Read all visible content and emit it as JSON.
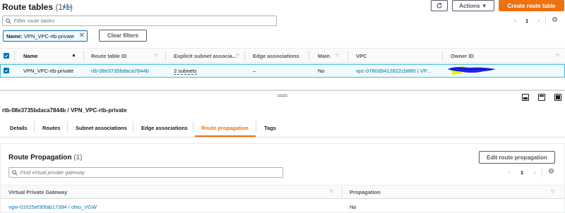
{
  "header": {
    "title": "Route tables",
    "count": "(1/1)",
    "info_label": "Info",
    "actions_label": "Actions ▼",
    "create_label": "Create route table"
  },
  "filter": {
    "placeholder": "Filter route tables",
    "chip_key": "Name:",
    "chip_value": "VPN_VPC-rtb-private",
    "clear_label": "Clear filters"
  },
  "pagination_top": {
    "page": "1"
  },
  "route_table": {
    "columns": [
      "Name",
      "Route table ID",
      "Explicit subnet associa...",
      "Edge associations",
      "Main",
      "VPC",
      "Owner ID"
    ],
    "row": {
      "name": "VPN_VPC-rtb-private",
      "route_table_id": "rtb-08e3735bdaca7844b",
      "subnets": "2 subnets",
      "edge": "–",
      "main": "No",
      "vpc": "vpc-0780d9412822cb880 | VP..."
    }
  },
  "detail": {
    "breadcrumb": "rtb-08e3735bdaca7844b / VPN_VPC-rtb-private",
    "tabs": [
      "Details",
      "Routes",
      "Subnet associations",
      "Edge associations",
      "Route propagation",
      "Tags"
    ],
    "active_tab": "Route propagation"
  },
  "propagation": {
    "title": "Route Propagation",
    "count": "(1)",
    "edit_label": "Edit route propagation",
    "search_placeholder": "Find virtual private gateway",
    "page": "1",
    "columns": [
      "Virtual Private Gateway",
      "Propagation"
    ],
    "row": {
      "gateway": "vgw-01625ef30fab17394 / ohio_VGW",
      "propagation": "No"
    }
  },
  "colors": {
    "accent": "#ec7211",
    "link": "#0073bb",
    "selected_row_bg": "#f1faff",
    "selected_row_border": "#44b9d6"
  }
}
